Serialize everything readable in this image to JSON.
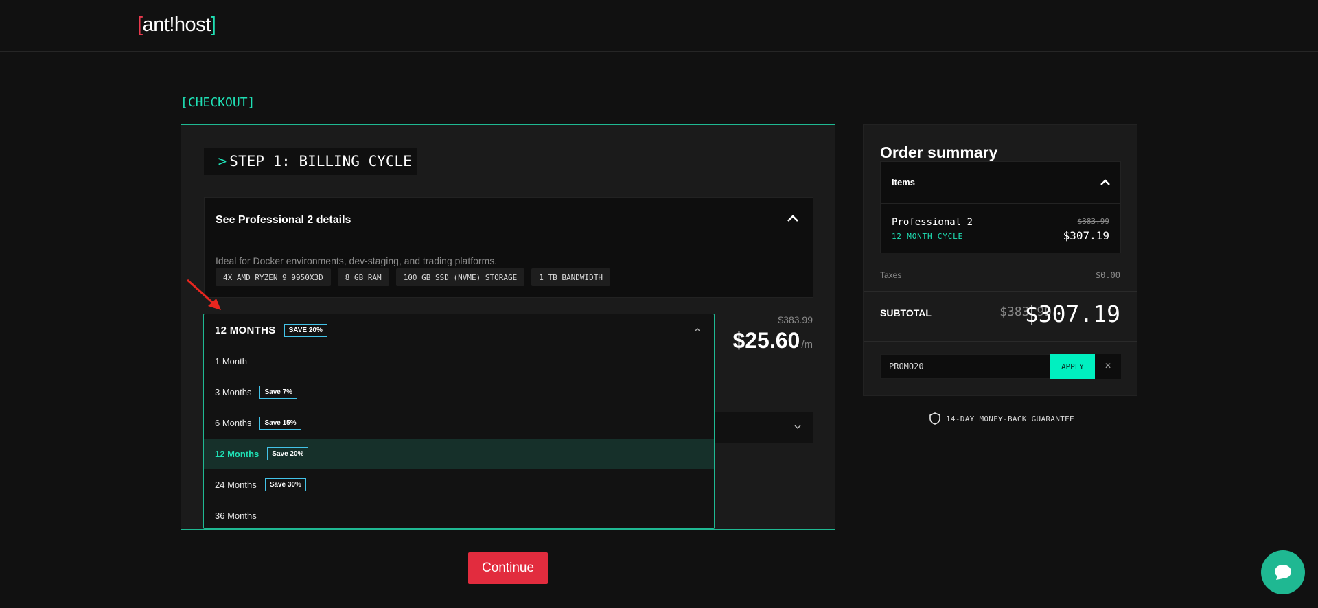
{
  "brand": {
    "bracket_left": "[",
    "name": "ant!host",
    "bracket_right": "]",
    "colors": {
      "accent": "#1fe0b5",
      "danger": "#e22c3e"
    }
  },
  "breadcrumb": "[CHECKOUT]",
  "step": {
    "prompt": "_>",
    "title": "STEP 1: BILLING CYCLE"
  },
  "details": {
    "header": "See Professional 2 details",
    "description": "Ideal for Docker environments, dev-staging, and trading platforms.",
    "specs": [
      "4X AMD RYZEN 9 9950X3D",
      "8 GB RAM",
      "100 GB SSD (NVME) STORAGE",
      "1 TB BANDWIDTH"
    ]
  },
  "pricing": {
    "old": "$383.99",
    "monthly": "$25.60",
    "per": "/m"
  },
  "billing_select": {
    "selected_label": "12 MONTHS",
    "selected_badge": "SAVE 20%",
    "options": [
      {
        "label": "1 Month",
        "badge": ""
      },
      {
        "label": "3 Months",
        "badge": "Save 7%"
      },
      {
        "label": "6 Months",
        "badge": "Save 15%"
      },
      {
        "label": "12 Months",
        "badge": "Save 20%"
      },
      {
        "label": "24 Months",
        "badge": "Save 30%"
      },
      {
        "label": "36 Months",
        "badge": ""
      }
    ]
  },
  "continue_label": "Continue",
  "summary": {
    "title": "Order summary",
    "items_header": "Items",
    "item_name": "Professional 2",
    "item_cycle": "12 MONTH CYCLE",
    "item_old_price": "$383.99",
    "item_price": "$307.19",
    "taxes_label": "Taxes",
    "taxes_value": "$0.00",
    "subtotal_label": "SUBTOTAL",
    "subtotal_old": "$383.99",
    "subtotal_new": "$307.19",
    "promo_value": "PROMO20",
    "apply_label": "APPLY",
    "clear_label": "×"
  },
  "guarantee": "14-DAY MONEY-BACK GUARANTEE",
  "icons": {
    "chat": "chat-bubble-icon",
    "shield": "shield-icon",
    "chevron_up": "chevron-up-icon",
    "chevron_down": "chevron-down-icon"
  }
}
